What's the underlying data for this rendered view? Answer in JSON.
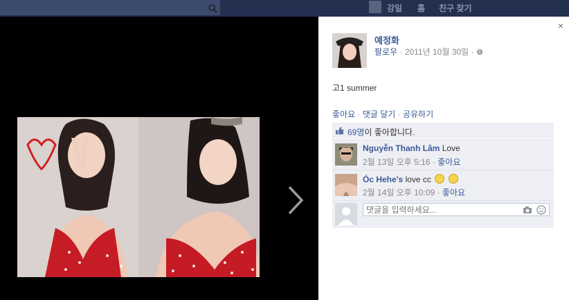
{
  "topbar": {
    "nav": [
      "강일",
      "홈",
      "친구 찾기"
    ]
  },
  "post": {
    "author": "예정화",
    "follow": "팔로우",
    "date": "2011년 10월 30일",
    "sep": "·",
    "caption": "고1 summer",
    "actions": [
      "좋아요",
      "댓글 달기",
      "공유하기"
    ]
  },
  "likes": {
    "count": "69명",
    "suffix": "이 좋아합니다."
  },
  "comments": [
    {
      "name": "Nguyễn Thanh Lâm",
      "text": "Love",
      "time": "2월 13일 오후 5:16",
      "like": "좋아요"
    },
    {
      "name": "Óc Hehe's",
      "text": "love cc",
      "time": "2월 14일 오후 10:09",
      "like": "좋아요"
    }
  ],
  "reply": {
    "placeholder": "댓글을 입력하세요..."
  },
  "icons": {
    "close": "×"
  }
}
